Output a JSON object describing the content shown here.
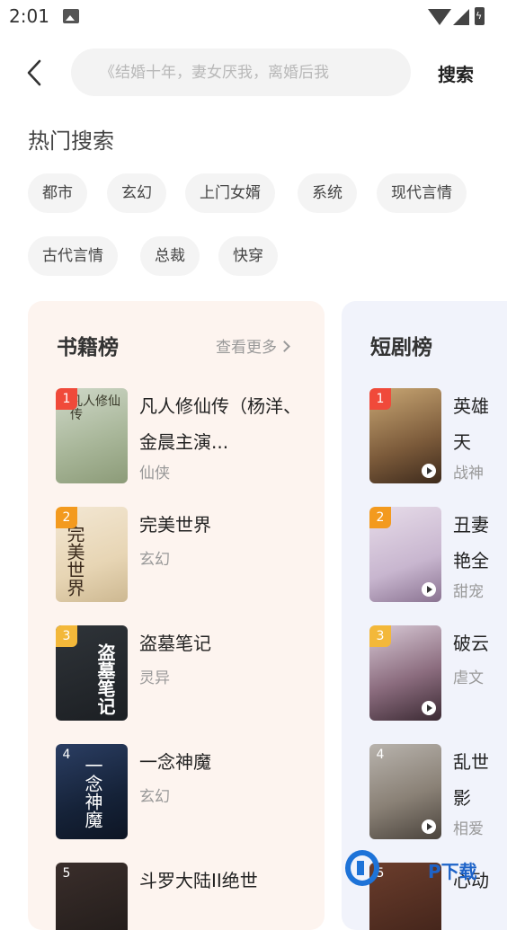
{
  "status_bar": {
    "time": "2:01"
  },
  "search": {
    "placeholder": "《结婚十年，妻女厌我，离婚后我",
    "button_label": "搜索"
  },
  "hot_search": {
    "title": "热门搜索",
    "tags": [
      "都市",
      "玄幻",
      "上门女婿",
      "系统",
      "现代言情",
      "古代言情",
      "总裁",
      "快穿"
    ]
  },
  "book_rank": {
    "title": "书籍榜",
    "more_label": "查看更多",
    "items": [
      {
        "rank": "1",
        "name": "凡人修仙传（杨洋、金晨主演...",
        "genre": "仙侠",
        "cover_text": "凡人修仙传"
      },
      {
        "rank": "2",
        "name": "完美世界",
        "genre": "玄幻",
        "cover_text": "完美世界"
      },
      {
        "rank": "3",
        "name": "盗墓笔记",
        "genre": "灵异",
        "cover_text": "盗墓笔记"
      },
      {
        "rank": "4",
        "name": "一念神魔",
        "genre": "玄幻",
        "cover_text": "一念神魔"
      },
      {
        "rank": "5",
        "name": "斗罗大陆II绝世",
        "genre": "",
        "cover_text": ""
      }
    ]
  },
  "drama_rank": {
    "title": "短剧榜",
    "items": [
      {
        "rank": "1",
        "name": "英雄天",
        "genre": "战神"
      },
      {
        "rank": "2",
        "name": "丑妻艳全",
        "genre": "甜宠"
      },
      {
        "rank": "3",
        "name": "破云",
        "genre": "虐文"
      },
      {
        "rank": "4",
        "name": "乱世影",
        "genre": "相爱"
      },
      {
        "rank": "5",
        "name": "心动",
        "genre": ""
      }
    ]
  },
  "watermark": {
    "text": "P下载"
  },
  "colors": {
    "rank1": "#f04a3a",
    "rank2": "#f39a1e",
    "rank3": "#f3b83a",
    "rank_other": "#b8b8b8"
  }
}
